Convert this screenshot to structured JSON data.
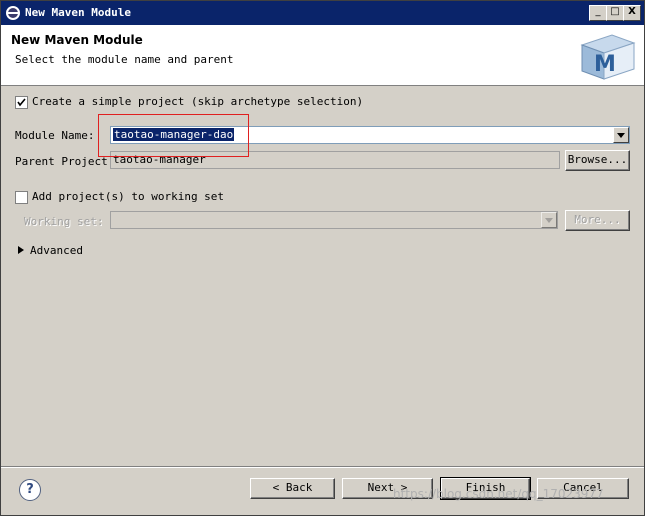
{
  "window": {
    "title": "New Maven Module",
    "minimize_label": "_",
    "maximize_label": "□",
    "close_label": "X"
  },
  "banner": {
    "title": "New Maven Module",
    "subtitle": "Select the module name and parent",
    "logo_letter": "M"
  },
  "form": {
    "simple_project": {
      "label": "Create a simple project (skip archetype selection)",
      "checked": true
    },
    "module_name": {
      "label": "Module Name:",
      "value": "taotao-manager-dao"
    },
    "parent_project": {
      "label": "Parent Project:",
      "value": "taotao-manager",
      "browse_label": "Browse..."
    },
    "working_set_toggle": {
      "label": "Add project(s) to working set",
      "checked": false
    },
    "working_set": {
      "label": "Working set:",
      "value": "",
      "more_label": "More..."
    },
    "advanced": {
      "label": "Advanced"
    }
  },
  "footer": {
    "help_label": "?",
    "back_label": "< Back",
    "next_label": "Next >",
    "finish_label": "Finish",
    "cancel_label": "Cancel"
  },
  "watermark": "https://blog.csdn.net/qq_17023977",
  "colors": {
    "title_bar": "#0a246a",
    "dialog_bg": "#d4d0c8",
    "annotation_box": "#e02020"
  }
}
